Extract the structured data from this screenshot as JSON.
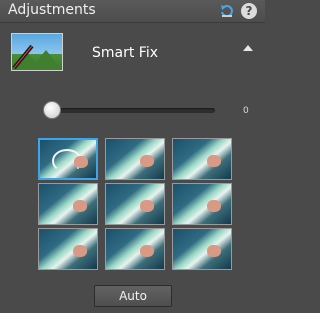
{
  "panel": {
    "title": "Adjustments",
    "icons": {
      "reset": "reset-icon",
      "help": "help-icon"
    },
    "help_glyph": "?"
  },
  "smart_fix": {
    "label": "Smart Fix",
    "thumbnail_icon": "smart-fix-thumbnail-icon",
    "collapse_icon": "collapse-arrow-icon"
  },
  "slider": {
    "value": "0",
    "level": 0
  },
  "presets": {
    "rows": 3,
    "columns": 3,
    "selected_index": 0
  },
  "auto_button": {
    "label": "Auto"
  },
  "colors": {
    "panel_bg": "#4a4a4a",
    "selection_border": "#3fa5e6"
  }
}
